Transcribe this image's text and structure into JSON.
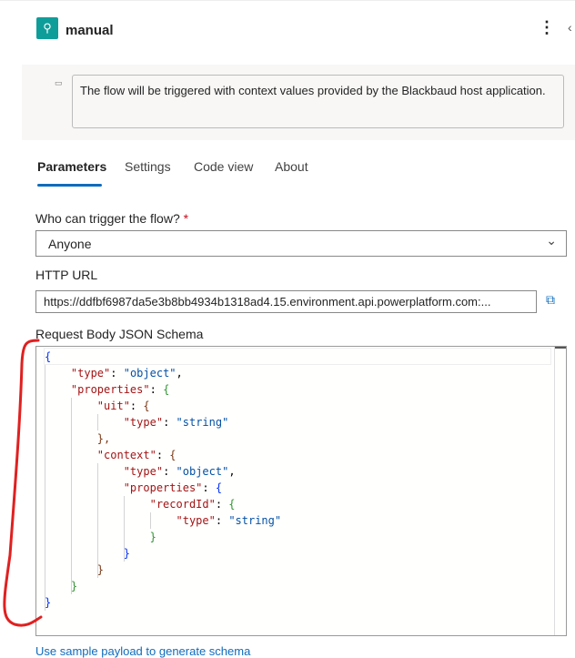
{
  "header": {
    "title": "manual",
    "icon": "trigger-icon",
    "more_icon": "more-vertical-icon",
    "collapse_icon": "chevron-left-icon"
  },
  "description": "The flow will be triggered with context values provided by the Blackbaud host application.",
  "tabs": [
    {
      "label": "Parameters",
      "active": true
    },
    {
      "label": "Settings"
    },
    {
      "label": "Code view"
    },
    {
      "label": "About"
    }
  ],
  "fields": {
    "who_label": "Who can trigger the flow?",
    "required_mark": "*",
    "who_value": "Anyone",
    "url_label": "HTTP URL",
    "url_value": "https://ddfbf6987da5e3b8bb4934b1318ad4.15.environment.api.powerplatform.com:...",
    "schema_label": "Request Body JSON Schema"
  },
  "schema_lines": [
    [
      "{"
    ],
    [
      "\"type\"",
      ": ",
      "\"object\"",
      ","
    ],
    [
      "\"properties\"",
      ": ",
      "{"
    ],
    [
      "\"uit\"",
      ": ",
      "{"
    ],
    [
      "\"type\"",
      ": ",
      "\"string\""
    ],
    [
      "},"
    ],
    [
      "\"context\"",
      ": ",
      "{"
    ],
    [
      "\"type\"",
      ": ",
      "\"object\"",
      ","
    ],
    [
      "\"properties\"",
      ": ",
      "{"
    ],
    [
      "\"recordId\"",
      ": ",
      "{"
    ],
    [
      "\"type\"",
      ": ",
      "\"string\""
    ],
    [
      "}"
    ],
    [
      "}"
    ],
    [
      "}"
    ],
    [
      "}"
    ],
    [
      "}"
    ]
  ],
  "sample_link": "Use sample payload to generate schema",
  "colors": {
    "accent": "#0f6cbd",
    "annotation": "#e02020",
    "key": "#a31515",
    "string": "#0451a5"
  }
}
